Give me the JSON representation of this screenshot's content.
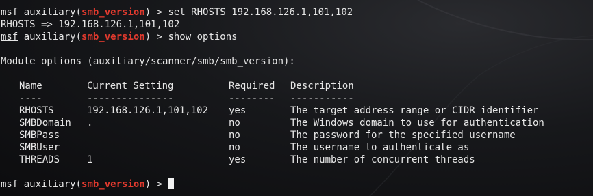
{
  "prompt": {
    "msf": "msf",
    "context_prefix": " auxiliary(",
    "module": "smb_version",
    "context_suffix": ") > "
  },
  "lines": {
    "cmd1": "set RHOSTS 192.168.126.1,101,102",
    "out1": "RHOSTS => 192.168.126.1,101,102",
    "cmd2": "show options",
    "header": "Module options (auxiliary/scanner/smb/smb_version):"
  },
  "table": {
    "headers": {
      "name": "Name",
      "current": "Current Setting",
      "required": "Required",
      "description": "Description"
    },
    "underlines": {
      "name": "----",
      "current": "---------------",
      "required": "--------",
      "description": "-----------"
    },
    "rows": [
      {
        "name": "RHOSTS",
        "current": "192.168.126.1,101,102",
        "required": "yes",
        "description": "The target address range or CIDR identifier"
      },
      {
        "name": "SMBDomain",
        "current": ".",
        "required": "no",
        "description": "The Windows domain to use for authentication"
      },
      {
        "name": "SMBPass",
        "current": "",
        "required": "no",
        "description": "The password for the specified username"
      },
      {
        "name": "SMBUser",
        "current": "",
        "required": "no",
        "description": "The username to authenticate as"
      },
      {
        "name": "THREADS",
        "current": "1",
        "required": "yes",
        "description": "The number of concurrent threads"
      }
    ]
  },
  "colors": {
    "background": "#0c0c0e",
    "text": "#e6e6e6",
    "module_highlight": "#e23a2e",
    "cursor": "#f2f2f2"
  }
}
